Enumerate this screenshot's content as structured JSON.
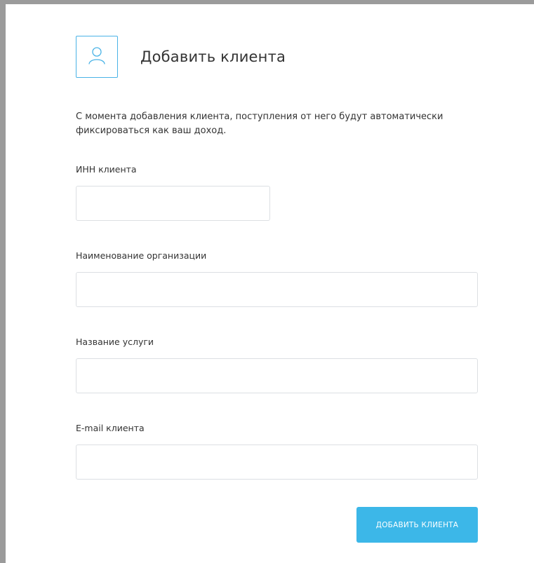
{
  "header": {
    "icon": "user-icon",
    "title": "Добавить клиента"
  },
  "description": "С момента добавления клиента, поступления от него будут автоматически фиксироваться как ваш доход.",
  "fields": {
    "inn": {
      "label": "ИНН клиента",
      "value": "",
      "placeholder": ""
    },
    "organization": {
      "label": "Наименование организации",
      "value": "",
      "placeholder": ""
    },
    "service": {
      "label": "Название услуги",
      "value": "",
      "placeholder": ""
    },
    "email": {
      "label": "E-mail клиента",
      "value": "",
      "placeholder": ""
    }
  },
  "submit": {
    "label": "ДОБАВИТЬ КЛИЕНТА"
  },
  "colors": {
    "accent": "#3cb7e8",
    "icon_border": "#4ab3e6",
    "input_border": "#dcdfe3",
    "frame": "#9b9b9b"
  }
}
